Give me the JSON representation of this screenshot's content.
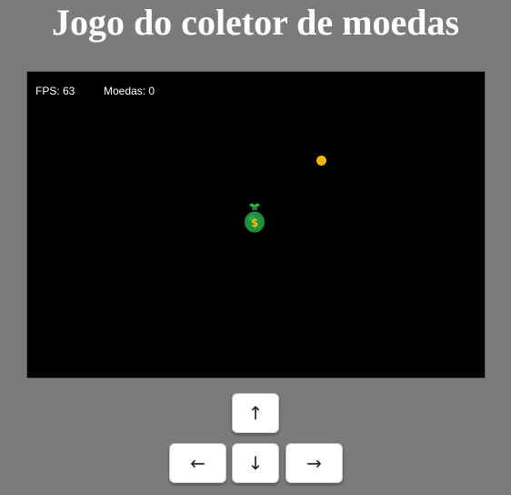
{
  "title": "Jogo do coletor de moedas",
  "hud": {
    "fps_label": "FPS: 63",
    "coins_label": "Moedas: 0"
  },
  "game": {
    "background_color": "#000000",
    "coin_color": "#f2b705",
    "player_color": "#1f8f3e",
    "player_symbol": "$",
    "player_symbol_color": "#f2c200"
  },
  "controls": {
    "up_label": "↑",
    "left_label": "←",
    "down_label": "↓",
    "right_label": "→"
  },
  "page_background": "#7b7b7b"
}
